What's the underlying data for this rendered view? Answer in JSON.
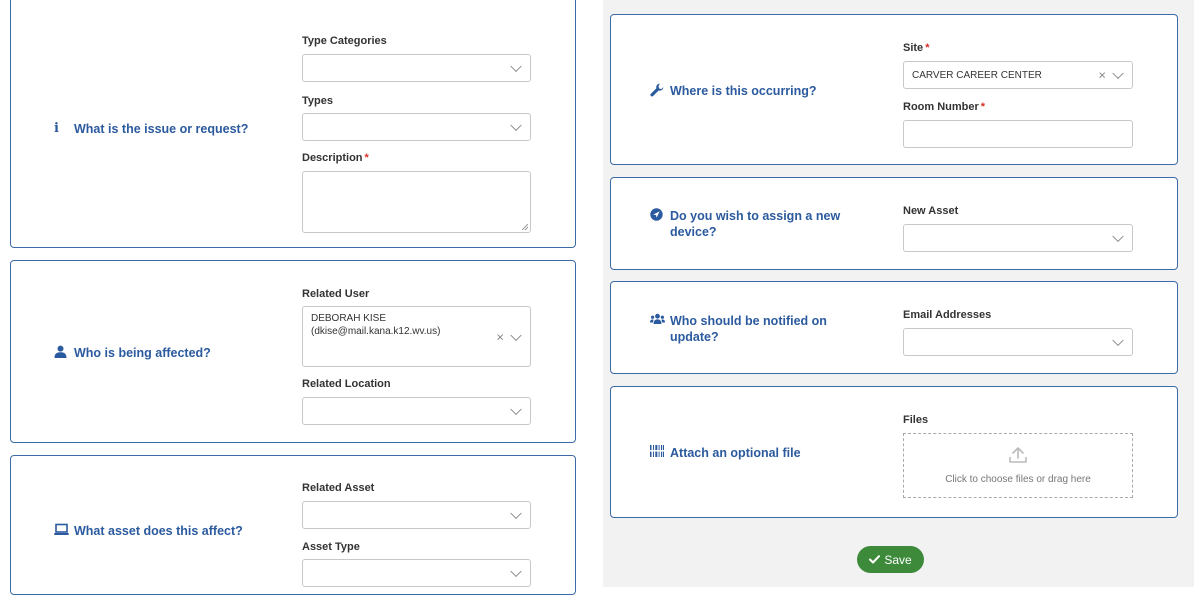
{
  "left": {
    "issue": {
      "question": "What is the issue or request?",
      "icon": "info-icon",
      "type_categories_label": "Type Categories",
      "types_label": "Types",
      "description_label": "Description",
      "required_mark": "*"
    },
    "affected": {
      "question": "Who is being affected?",
      "icon": "user-icon",
      "related_user_label": "Related User",
      "related_user_name": "DEBORAH KISE",
      "related_user_email": "(dkise@mail.kana.k12.wv.us)",
      "related_location_label": "Related Location"
    },
    "asset": {
      "question": "What asset does this affect?",
      "icon": "laptop-icon",
      "related_asset_label": "Related Asset",
      "asset_type_label": "Asset Type"
    }
  },
  "right": {
    "location": {
      "question": "Where is this occurring?",
      "icon": "wrench-icon",
      "site_label": "Site",
      "site_value": "CARVER CAREER CENTER",
      "room_label": "Room Number",
      "required_mark": "*"
    },
    "device": {
      "question_line1": "Do you wish to assign a new",
      "question_line2": "device?",
      "icon": "location-arrow-icon",
      "new_asset_label": "New Asset"
    },
    "notify": {
      "question_line1": "Who should be notified on",
      "question_line2": "update?",
      "icon": "users-icon",
      "email_label": "Email Addresses"
    },
    "attach": {
      "question": "Attach an optional file",
      "icon": "barcode-icon",
      "files_label": "Files",
      "drop_text": "Click to choose files or drag here"
    }
  },
  "save_label": "Save",
  "colors": {
    "accent": "#2b5a9e",
    "border": "#3d6ba8",
    "save": "#3c8a3a",
    "required": "#d93025"
  }
}
